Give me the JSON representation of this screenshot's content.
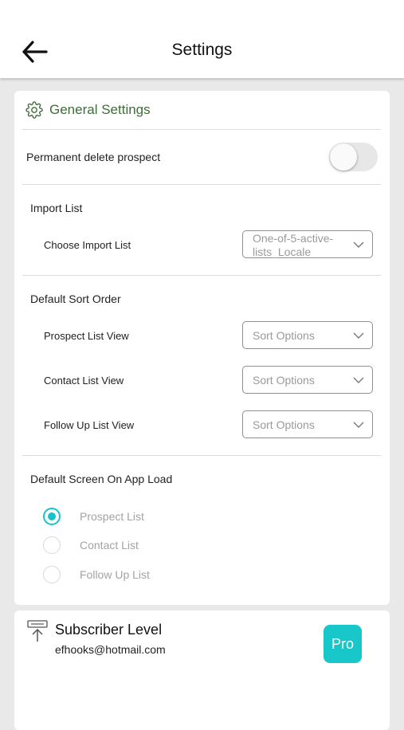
{
  "header": {
    "title": "Settings",
    "back_icon": "arrow-left-icon"
  },
  "general": {
    "title": "General Settings",
    "icon": "gear-icon",
    "accent_color": "#3f6b3a",
    "permanent_delete": {
      "label": "Permanent delete prospect",
      "enabled": false
    },
    "import_list": {
      "heading": "Import List",
      "choose_label": "Choose Import List",
      "selected": "One-of-5-active-lists_Locale"
    },
    "sort_order": {
      "heading": "Default Sort Order",
      "rows": [
        {
          "label": "Prospect List View",
          "placeholder": "Sort Options"
        },
        {
          "label": "Contact List View",
          "placeholder": "Sort Options"
        },
        {
          "label": "Follow Up List View",
          "placeholder": "Sort Options"
        }
      ]
    },
    "default_screen": {
      "heading": "Default Screen On App Load",
      "options": [
        {
          "label": "Prospect List",
          "selected": true
        },
        {
          "label": "Contact List",
          "selected": false
        },
        {
          "label": "Follow Up List",
          "selected": false
        }
      ],
      "selected_color": "#16c3c8"
    }
  },
  "subscriber": {
    "title": "Subscriber Level",
    "email": "efhooks@hotmail.com",
    "badge": "Pro",
    "badge_color": "#18c7c9",
    "icon": "subscription-upgrade-icon"
  }
}
